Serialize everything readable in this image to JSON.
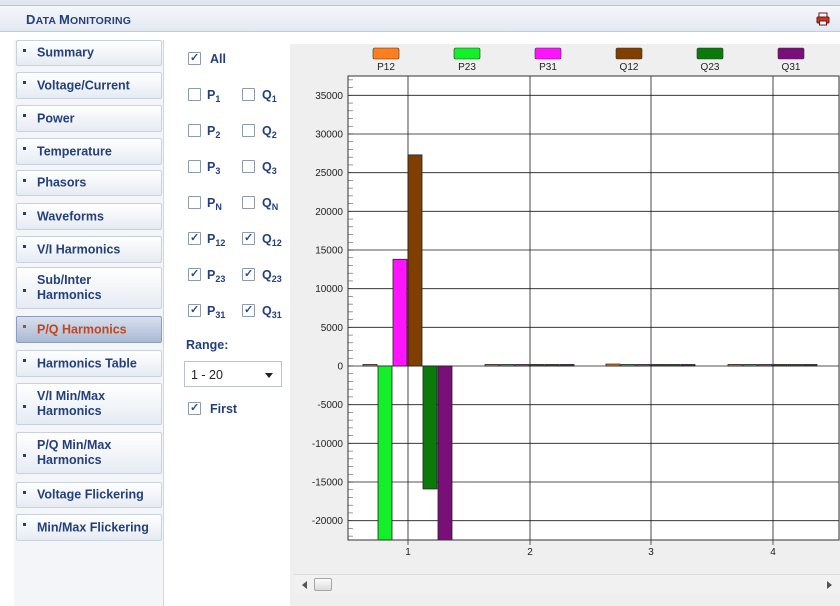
{
  "header": {
    "title_cap1": "D",
    "title_rest1": "ATA ",
    "title_cap2": "M",
    "title_rest2": "ONITORING",
    "print_icon": "printer-icon"
  },
  "sidebar": {
    "items": [
      {
        "label": "Summary"
      },
      {
        "label": "Voltage/Current"
      },
      {
        "label": "Power"
      },
      {
        "label": "Temperature"
      },
      {
        "label": "Phasors"
      },
      {
        "label": "Waveforms"
      },
      {
        "label": "V/I Harmonics"
      },
      {
        "label": "Sub/Inter\nHarmonics"
      },
      {
        "label": "P/Q Harmonics",
        "active": true
      },
      {
        "label": "Harmonics Table"
      },
      {
        "label": "V/I Min/Max\nHarmonics"
      },
      {
        "label": "P/Q Min/Max\nHarmonics"
      },
      {
        "label": "Voltage Flickering"
      },
      {
        "label": "Min/Max Flickering"
      }
    ]
  },
  "filters": {
    "all": {
      "label": "All",
      "checked": true
    },
    "pairs": [
      {
        "p": "P",
        "p_sub": "1",
        "p_checked": false,
        "q": "Q",
        "q_sub": "1",
        "q_checked": false
      },
      {
        "p": "P",
        "p_sub": "2",
        "p_checked": false,
        "q": "Q",
        "q_sub": "2",
        "q_checked": false
      },
      {
        "p": "P",
        "p_sub": "3",
        "p_checked": false,
        "q": "Q",
        "q_sub": "3",
        "q_checked": false
      },
      {
        "p": "P",
        "p_sub": "N",
        "p_checked": false,
        "q": "Q",
        "q_sub": "N",
        "q_checked": false
      },
      {
        "p": "P",
        "p_sub": "12",
        "p_checked": true,
        "q": "Q",
        "q_sub": "12",
        "q_checked": true
      },
      {
        "p": "P",
        "p_sub": "23",
        "p_checked": true,
        "q": "Q",
        "q_sub": "23",
        "q_checked": true
      },
      {
        "p": "P",
        "p_sub": "31",
        "p_checked": true,
        "q": "Q",
        "q_sub": "31",
        "q_checked": true
      }
    ],
    "range_label": "Range:",
    "range_value": "1 - 20",
    "first": {
      "label": "First",
      "checked": true
    }
  },
  "chart_data": {
    "type": "bar",
    "categories": [
      "1",
      "2",
      "3",
      "4"
    ],
    "ylim": [
      -22500,
      37500
    ],
    "y_ticks": [
      35000,
      30000,
      25000,
      20000,
      15000,
      10000,
      5000,
      0,
      -5000,
      -10000,
      -15000,
      -20000
    ],
    "legend_placement": "top",
    "grid": true,
    "series": [
      {
        "name": "P12",
        "color": "#ff7f1e",
        "values": [
          150,
          0,
          250,
          0
        ]
      },
      {
        "name": "P23",
        "color": "#11f028",
        "values": [
          -22500,
          0,
          0,
          0
        ]
      },
      {
        "name": "P31",
        "color": "#ff14ff",
        "values": [
          13800,
          0,
          0,
          0
        ]
      },
      {
        "name": "Q12",
        "color": "#7f3f00",
        "values": [
          27300,
          0,
          0,
          0
        ]
      },
      {
        "name": "Q23",
        "color": "#0a7a0a",
        "values": [
          -15900,
          0,
          0,
          0
        ]
      },
      {
        "name": "Q31",
        "color": "#7a0f7a",
        "values": [
          -22500,
          0,
          0,
          0
        ]
      }
    ]
  }
}
